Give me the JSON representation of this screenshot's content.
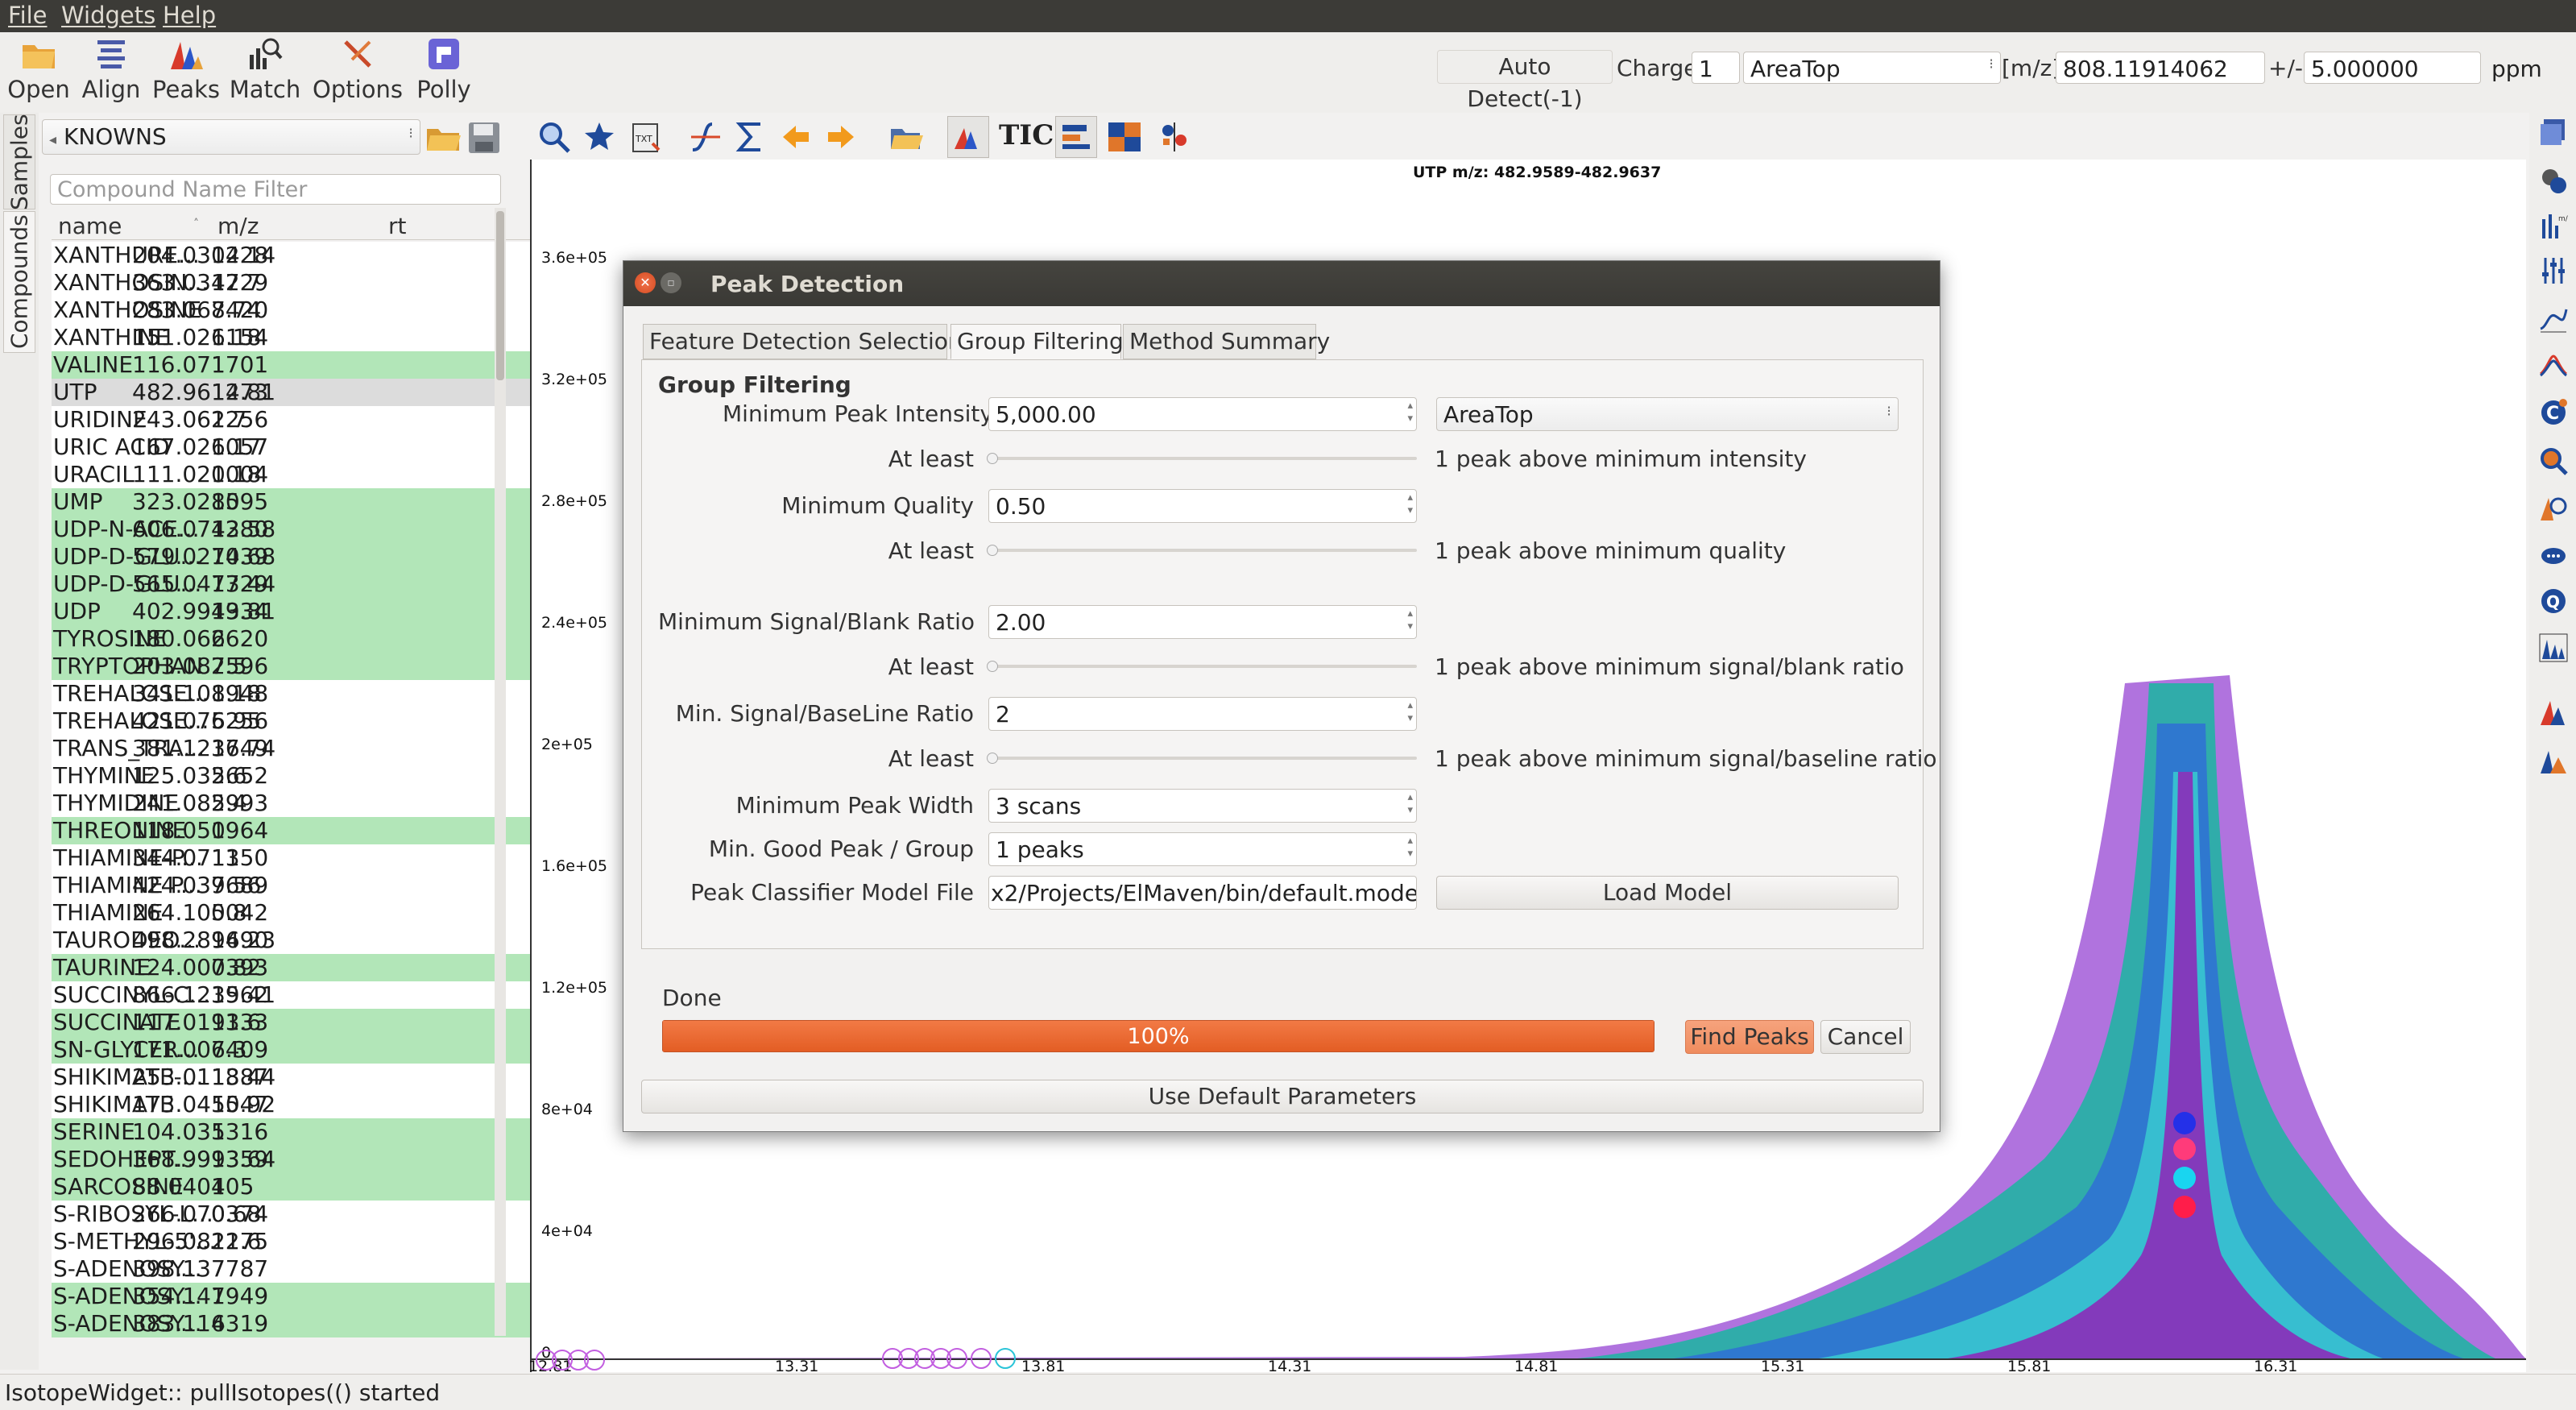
{
  "menu": {
    "file": "File",
    "widgets": "Widgets",
    "help": "Help"
  },
  "toolbar": {
    "buttons": [
      {
        "label": "Open",
        "icon": "folder-icon"
      },
      {
        "label": "Align",
        "icon": "align-icon"
      },
      {
        "label": "Peaks",
        "icon": "peaks-icon"
      },
      {
        "label": "Match",
        "icon": "match-icon"
      },
      {
        "label": "Options",
        "icon": "options-icon"
      },
      {
        "label": "Polly",
        "icon": "polly-icon"
      }
    ],
    "auto_detect": "Auto Detect(-1)",
    "charge_label": "Charge",
    "charge_value": "1",
    "quant_type": "AreaTop",
    "mz_label": "[m/z]",
    "mz_value": "808.11914062",
    "tol_label": "+/-",
    "tol_value": "5.000000",
    "tol_unit": "ppm"
  },
  "side_tabs": {
    "samples": "Samples",
    "compounds": "Compounds"
  },
  "compounds": {
    "database": "KNOWNS",
    "filter_placeholder": "Compound Name Filter",
    "columns": [
      "name",
      "m/z",
      "rt"
    ],
    "rows": [
      {
        "name": "XANTHURE...",
        "mz": "204.030228",
        "rt": "14.14",
        "hl": false
      },
      {
        "name": "XANTHOSIN...",
        "mz": "363.034729",
        "rt": "12.7",
        "hl": false
      },
      {
        "name": "XANTHOSINE",
        "mz": "283.068420",
        "rt": "7.74",
        "hl": false
      },
      {
        "name": "XANTHINE",
        "mz": "151.026154",
        "rt": "1.18",
        "hl": false
      },
      {
        "name": "VALINE",
        "mz": "116.071701",
        "rt": "1",
        "hl": true
      },
      {
        "name": "UTP",
        "mz": "482.961273",
        "rt": "14.81",
        "hl": false,
        "sel": true
      },
      {
        "name": "URIDINE",
        "mz": "243.062256",
        "rt": "1.7",
        "hl": false
      },
      {
        "name": "URIC ACID",
        "mz": "167.021057",
        "rt": "6.17",
        "hl": false
      },
      {
        "name": "URACIL",
        "mz": "111.020004",
        "rt": "1.18",
        "hl": false
      },
      {
        "name": "UMP",
        "mz": "323.028595",
        "rt": "10",
        "hl": true
      },
      {
        "name": "UDP-N-ACE...",
        "mz": "606.074280",
        "rt": "13.58",
        "hl": true
      },
      {
        "name": "UDP-D-GLU...",
        "mz": "579.027039",
        "rt": "14.68",
        "hl": true
      },
      {
        "name": "UDP-D-GLU...",
        "mz": "565.047729",
        "rt": "13.44",
        "hl": true
      },
      {
        "name": "UDP",
        "mz": "402.994934",
        "rt": "13.81",
        "hl": true
      },
      {
        "name": "TYROSINE",
        "mz": "180.066620",
        "rt": "2",
        "hl": true
      },
      {
        "name": "TRYPTOPHAN",
        "mz": "203.082596",
        "rt": "7.5",
        "hl": true
      },
      {
        "name": "TREHALOSE...",
        "mz": "341.108948",
        "rt": "1.18",
        "hl": false
      },
      {
        "name": "TREHALOSE...",
        "mz": "421.075256",
        "rt": "6.95",
        "hl": false
      },
      {
        "name": "TRANS_TRA...",
        "mz": "381.123749",
        "rt": "16.74",
        "hl": false
      },
      {
        "name": "THYMINE",
        "mz": "125.035652",
        "rt": "2.6",
        "hl": false
      },
      {
        "name": "THYMIDINE",
        "mz": "241.082993",
        "rt": "5.4",
        "hl": false
      },
      {
        "name": "THREONINE",
        "mz": "118.050964",
        "rt": "1",
        "hl": true
      },
      {
        "name": "THIAMINE-P...",
        "mz": "344.071350",
        "rt": "11",
        "hl": false
      },
      {
        "name": "THIAMINE P...",
        "mz": "424.037689",
        "rt": "9.56",
        "hl": false
      },
      {
        "name": "THIAMINE",
        "mz": "264.105042",
        "rt": "0.8",
        "hl": false
      },
      {
        "name": "TAURODEO...",
        "mz": "498.289490",
        "rt": "16.23",
        "hl": false
      },
      {
        "name": "TAURINE",
        "mz": "124.007393",
        "rt": "0.82",
        "hl": true
      },
      {
        "name": "SUCCINYL-C...",
        "mz": "866.123962",
        "rt": "15.41",
        "hl": false
      },
      {
        "name": "SUCCINATE",
        "mz": "117.019333",
        "rt": "11.6",
        "hl": true
      },
      {
        "name": "SN-GLYCER...",
        "mz": "171.006409",
        "rt": "7.3",
        "hl": true
      },
      {
        "name": "SHIKIMATE-...",
        "mz": "253.011887",
        "rt": "13.44",
        "hl": false
      },
      {
        "name": "SHIKIMATE",
        "mz": "173.045547",
        "rt": "10.92",
        "hl": false
      },
      {
        "name": "SERINE",
        "mz": "104.035316",
        "rt": "1",
        "hl": true
      },
      {
        "name": "SEDOHEPT...",
        "mz": "368.999359",
        "rt": "13.64",
        "hl": true
      },
      {
        "name": "SARCOSINE",
        "mz": "88.040405",
        "rt": "1",
        "hl": true
      },
      {
        "name": "S-RIBOSYL-L...",
        "mz": "266.070374",
        "rt": "0.68",
        "hl": false
      },
      {
        "name": "S-METHYL-5'...",
        "mz": "296.082275",
        "rt": "11.6",
        "hl": false
      },
      {
        "name": "S-ADENOSY...",
        "mz": "398.137787",
        "rt": "7",
        "hl": false
      },
      {
        "name": "S-ADENOSY...",
        "mz": "354.147949",
        "rt": "1",
        "hl": true
      },
      {
        "name": "S-ADENOSY...",
        "mz": "383.114319",
        "rt": "6",
        "hl": true
      }
    ]
  },
  "plot": {
    "title": "UTP m/z: 482.9589-482.9637",
    "y_ticks": [
      "3.6e+05",
      "3.2e+05",
      "2.8e+05",
      "2.4e+05",
      "2e+05",
      "1.6e+05",
      "1.2e+05",
      "8e+04",
      "4e+04",
      "0"
    ],
    "x_ticks": [
      "12.81",
      "13.31",
      "13.81",
      "14.31",
      "14.81",
      "15.31",
      "15.81",
      "16.31"
    ],
    "peak_rt": "14.81"
  },
  "dialog": {
    "title": "Peak Detection",
    "tabs": [
      "Feature Detection Selection",
      "Group Filtering",
      "Method Summary"
    ],
    "section": "Group Filtering",
    "min_intensity_label": "Minimum Peak Intensity",
    "min_intensity_value": "5,000.00",
    "intensity_type": "AreaTop",
    "at_least": "At least",
    "intensity_hint": "1 peak above minimum intensity",
    "min_quality_label": "Minimum Quality",
    "min_quality_value": "0.50",
    "quality_hint": "1 peak above minimum quality",
    "sb_label": "Minimum Signal/Blank Ratio",
    "sb_value": "2.00",
    "sb_hint": "1 peak above minimum signal/blank ratio",
    "sbl_label": "Min. Signal/BaseLine Ratio",
    "sbl_value": "2",
    "sbl_hint": "1 peak above minimum signal/baseline ratio",
    "width_label": "Minimum Peak Width",
    "width_value": "3 scans",
    "good_label": "Min. Good Peak / Group",
    "good_value": "1 peaks",
    "model_label": "Peak Classifier Model File",
    "model_value": "x2/Projects/ElMaven/bin/default.model",
    "load_model": "Load Model",
    "status": "Done",
    "progress": 1.0,
    "progress_text": "100%",
    "find_peaks": "Find Peaks",
    "cancel": "Cancel",
    "defaults": "Use Default Parameters"
  },
  "status_bar": "IsotopeWidget:: pullIsotopes(() started",
  "colors": {
    "highlight": "#b2e6b8",
    "progress": "#e9642f",
    "accent": "#f39b6f"
  }
}
